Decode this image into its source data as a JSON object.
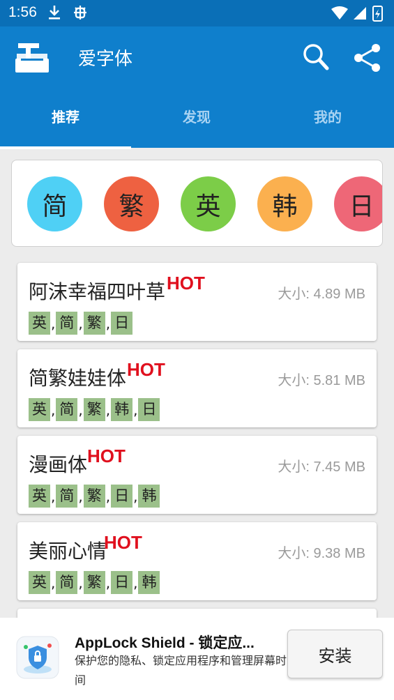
{
  "status_bar": {
    "time": "1:56",
    "download_icon": "download-icon",
    "bug_icon": "bug-icon"
  },
  "app_bar": {
    "title": "爱字体",
    "logo_icon": "app-logo-icon",
    "search_icon": "search-icon",
    "share_icon": "share-icon",
    "background": "#0f7fcc",
    "status_background": "#0a6fb7"
  },
  "tabs": [
    {
      "label": "推荐",
      "active": true
    },
    {
      "label": "发现",
      "active": false
    },
    {
      "label": "我的",
      "active": false
    }
  ],
  "languages": [
    {
      "label": "简",
      "color": "#4fd0f5"
    },
    {
      "label": "繁",
      "color": "#ee6141"
    },
    {
      "label": "英",
      "color": "#7ccd48"
    },
    {
      "label": "韩",
      "color": "#fbb04f"
    },
    {
      "label": "日",
      "color": "#ee6777"
    }
  ],
  "fonts": [
    {
      "name": "阿沫幸福四叶草",
      "hot": "HOT",
      "size": "大小: 4.89 MB",
      "tags": [
        "英",
        "简",
        "繁",
        "日"
      ]
    },
    {
      "name": "简繁娃娃体",
      "hot": "HOT",
      "size": "大小: 5.81 MB",
      "tags": [
        "英",
        "简",
        "繁",
        "韩",
        "日"
      ]
    },
    {
      "name": "漫画体",
      "hot": "HOT",
      "size": "大小: 7.45 MB",
      "tags": [
        "英",
        "简",
        "繁",
        "日",
        "韩"
      ]
    },
    {
      "name": "美丽心情",
      "hot": "HOT",
      "size": "大小: 9.38 MB",
      "tags": [
        "英",
        "简",
        "繁",
        "日",
        "韩"
      ]
    }
  ],
  "tag_separator": ",",
  "ad": {
    "title": "AppLock Shield - 锁定应...",
    "description": "保护您的隐私、锁定应用程序和管理屏幕时间",
    "button": "安装",
    "icon": "app-shield-icon"
  }
}
